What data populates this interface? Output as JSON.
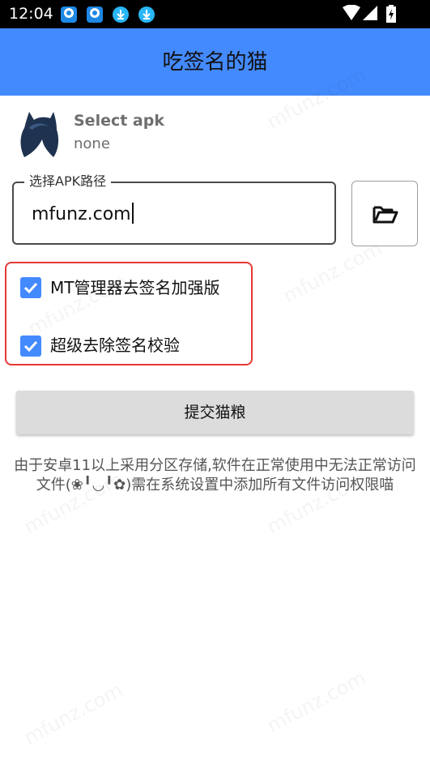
{
  "status_bar": {
    "time": "12:04",
    "notifications": [
      "app-icon",
      "app-icon",
      "download-icon",
      "download-icon"
    ],
    "indicators": [
      "wifi-icon",
      "signal-icon",
      "battery-charging-icon"
    ]
  },
  "app_bar": {
    "title": "吃签名的猫"
  },
  "apk": {
    "title": "Select apk",
    "subtitle": "none"
  },
  "path_input": {
    "label": "选择APK路径",
    "value": "mfunz.com"
  },
  "options": [
    {
      "label": "MT管理器去签名加强版",
      "checked": true
    },
    {
      "label": "超级去除签名校验",
      "checked": true
    }
  ],
  "submit": {
    "label": "提交猫粮"
  },
  "info_text": "由于安卓11以上采用分区存储,软件在正常使用中无法正常访问文件(❀╹◡╹✿)需在系统设置中添加所有文件访问权限喵",
  "watermark": "mfunz.com",
  "colors": {
    "app_bar": "#448aff",
    "checkbox": "#448aff",
    "highlight": "#e53935",
    "status_bar": "#000000"
  }
}
